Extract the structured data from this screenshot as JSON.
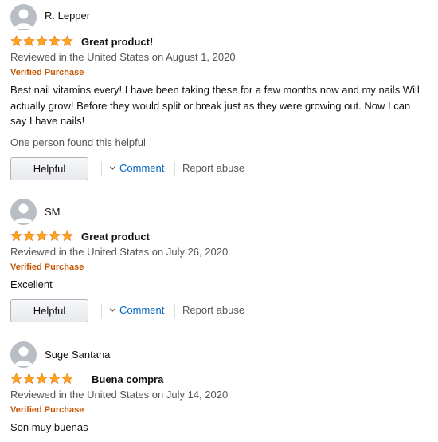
{
  "colors": {
    "star": "#ffa41c",
    "verified": "#c45500",
    "link": "#0066c0",
    "muted": "#555555"
  },
  "icons": {
    "avatar": "default-profile-avatar",
    "star": "filled-star",
    "chevron": "chevron-down"
  },
  "reviews": [
    {
      "author": "R. Lepper",
      "rating": 5,
      "title": "Great product!",
      "date": "Reviewed in the United States on August 1, 2020",
      "verified": "Verified Purchase",
      "body": "Best nail vitamins every! I have been taking these for a few months now and my nails Will actually grow! Before they would split or break just as they were growing out. Now I can say I have nails!",
      "helpful_count_text": "One person found this helpful",
      "helpful_label": "Helpful",
      "comment_label": "Comment",
      "report_label": "Report abuse"
    },
    {
      "author": "SM",
      "rating": 5,
      "title": "Great product",
      "date": "Reviewed in the United States on July 26, 2020",
      "verified": "Verified Purchase",
      "body": "Excellent",
      "helpful_label": "Helpful",
      "comment_label": "Comment",
      "report_label": "Report abuse"
    },
    {
      "author": "Suge Santana",
      "rating": 5,
      "title": "Buena compra",
      "date": "Reviewed in the United States on July 14, 2020",
      "verified": "Verified Purchase",
      "body": "Son muy buenas"
    }
  ]
}
